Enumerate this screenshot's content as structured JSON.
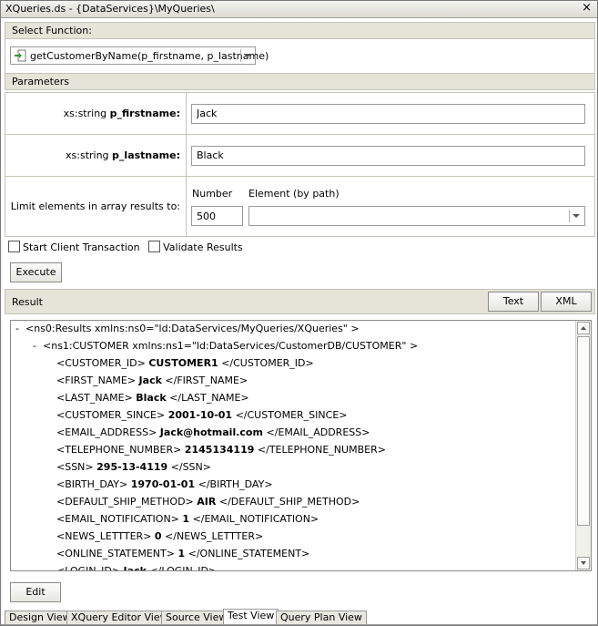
{
  "window": {
    "title": "XQueries.ds - {DataServices}\\MyQueries\\"
  },
  "select_function": {
    "header": "Select Function:",
    "value": "getCustomerByName(p_firstname, p_lastname)"
  },
  "parameters": {
    "header": "Parameters",
    "rows": [
      {
        "type": "xs:string",
        "name": "p_firstname:",
        "value": "Jack"
      },
      {
        "type": "xs:string",
        "name": "p_lastname:",
        "value": "Black"
      }
    ],
    "limit": {
      "label": "Limit elements in array results to:",
      "number_label": "Number",
      "number_value": "500",
      "element_label": "Element (by path)",
      "element_value": ""
    }
  },
  "options": {
    "start_client_transaction": "Start Client Transaction",
    "validate_results": "Validate Results"
  },
  "buttons": {
    "execute": "Execute",
    "text": "Text",
    "xml": "XML",
    "edit": "Edit"
  },
  "result": {
    "header": "Result",
    "root_toggle": "-",
    "root": "<ns0:Results xmlns:ns0=\"ld:DataServices/MyQueries/XQueries\" >",
    "customer_toggle": "-",
    "customer": "<ns1:CUSTOMER xmlns:ns1=\"ld:DataServices/CustomerDB/CUSTOMER\" >",
    "fields": [
      {
        "open": "<CUSTOMER_ID>",
        "value": "CUSTOMER1",
        "close": "</CUSTOMER_ID>"
      },
      {
        "open": "<FIRST_NAME>",
        "value": "Jack",
        "close": "</FIRST_NAME>"
      },
      {
        "open": "<LAST_NAME>",
        "value": "Black",
        "close": "</LAST_NAME>"
      },
      {
        "open": "<CUSTOMER_SINCE>",
        "value": "2001-10-01",
        "close": "</CUSTOMER_SINCE>"
      },
      {
        "open": "<EMAIL_ADDRESS>",
        "value": "Jack@hotmail.com",
        "close": "</EMAIL_ADDRESS>"
      },
      {
        "open": "<TELEPHONE_NUMBER>",
        "value": "2145134119",
        "close": "</TELEPHONE_NUMBER>"
      },
      {
        "open": "<SSN>",
        "value": "295-13-4119",
        "close": "</SSN>"
      },
      {
        "open": "<BIRTH_DAY>",
        "value": "1970-01-01",
        "close": "</BIRTH_DAY>"
      },
      {
        "open": "<DEFAULT_SHIP_METHOD>",
        "value": "AIR",
        "close": "</DEFAULT_SHIP_METHOD>"
      },
      {
        "open": "<EMAIL_NOTIFICATION>",
        "value": "1",
        "close": "</EMAIL_NOTIFICATION>"
      },
      {
        "open": "<NEWS_LETTTER>",
        "value": "0",
        "close": "</NEWS_LETTTER>"
      },
      {
        "open": "<ONLINE_STATEMENT>",
        "value": "1",
        "close": "</ONLINE_STATEMENT>"
      },
      {
        "open": "<LOGIN_ID>",
        "value": "Jack",
        "close": "</LOGIN_ID>"
      }
    ]
  },
  "tabs": [
    "Design View",
    "XQuery Editor View",
    "Source View",
    "Test View",
    "Query Plan View"
  ],
  "active_tab": "Test View",
  "icons": {
    "function": "function-arrow-icon",
    "close": "close-icon"
  },
  "colors": {
    "section_header": "#e4e4d9",
    "icon_green": "#2a9a2a"
  }
}
